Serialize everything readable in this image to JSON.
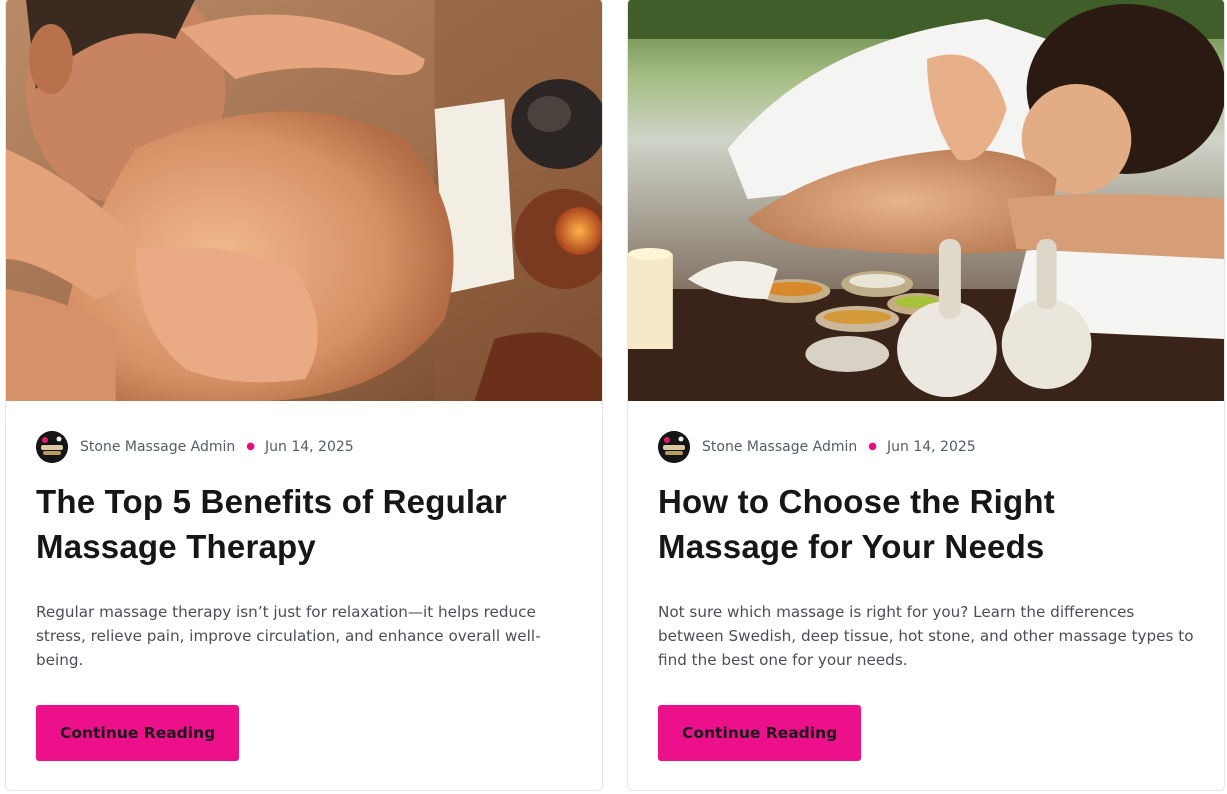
{
  "posts": [
    {
      "author": "Stone Massage Admin",
      "date": "Jun 14, 2025",
      "title": "The Top 5 Benefits of Regular Massage Therapy",
      "excerpt": "Regular massage therapy isn’t just for relaxation—it helps reduce stress, relieve pain, improve circulation, and enhance overall well-being.",
      "button": "Continue Reading"
    },
    {
      "author": "Stone Massage Admin",
      "date": "Jun 14, 2025",
      "title": "How to Choose the Right Massage for Your Needs",
      "excerpt": "Not sure which massage is right for you? Learn the differences between Swedish, deep tissue, hot stone, and other massage types to find the best one for your needs.",
      "button": "Continue Reading"
    }
  ],
  "colors": {
    "accent": "#ec118a",
    "dot": "#e3107f",
    "title": "#161616",
    "meta": "#555d66"
  }
}
